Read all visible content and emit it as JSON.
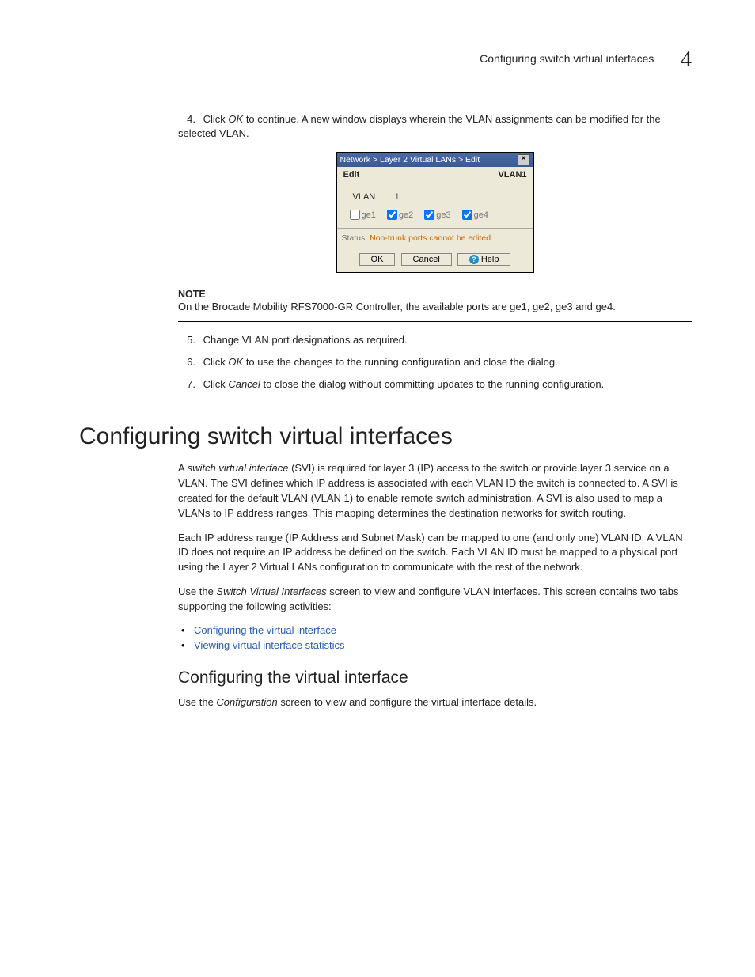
{
  "header": {
    "title": "Configuring switch virtual interfaces",
    "chapter": "4"
  },
  "step4": {
    "num": "4.",
    "prefix": "Click ",
    "ok": "OK",
    "rest": " to continue. A new window displays wherein the VLAN assignments can be modified for the selected VLAN."
  },
  "dialog": {
    "breadcrumb": "Network > Layer 2 Virtual LANs > Edit",
    "edit": "Edit",
    "vlan_name": "VLAN1",
    "vlan_label": "VLAN",
    "vlan_value": "1",
    "ports": {
      "ge1": "ge1",
      "ge2": "ge2",
      "ge3": "ge3",
      "ge4": "ge4"
    },
    "status_label": "Status:",
    "status_msg": "Non-trunk ports cannot be edited",
    "ok_btn": "OK",
    "cancel_btn": "Cancel",
    "help_btn": "Help"
  },
  "note": {
    "label": "NOTE",
    "body": "On the Brocade Mobility RFS7000-GR Controller, the available ports are ge1, ge2, ge3 and ge4."
  },
  "step5": {
    "num": "5.",
    "text": "Change VLAN port designations as required."
  },
  "step6": {
    "num": "6.",
    "prefix": "Click ",
    "ok": "OK",
    "rest": " to use the changes to the running configuration and close the dialog."
  },
  "step7": {
    "num": "7.",
    "prefix": "Click ",
    "cancel": "Cancel",
    "rest": " to close the dialog without committing updates to the running configuration."
  },
  "h1": "Configuring switch virtual interfaces",
  "p1": {
    "a": "A ",
    "svi": "switch virtual interface",
    "b": " (SVI) is required for layer 3 (IP) access to the switch or provide layer 3 service on a VLAN. The SVI defines which IP address is associated with each VLAN ID the switch is connected to. A SVI is created for the default VLAN (VLAN 1) to enable remote switch administration. A SVI is also used to map a VLANs to IP address ranges. This mapping determines the destination networks for switch routing."
  },
  "p2": "Each IP address range (IP Address and Subnet Mask) can be mapped to one (and only one) VLAN ID. A VLAN ID does not require an IP address be defined on the switch. Each VLAN ID must be mapped to a physical port using the Layer 2 Virtual LANs configuration to communicate with the rest of the network.",
  "p3": {
    "a": "Use the ",
    "screen": "Switch Virtual Interfaces",
    "b": " screen to view and configure VLAN interfaces. This screen contains two tabs supporting the following activities:"
  },
  "links": {
    "l1": "Configuring the virtual interface",
    "l2": "Viewing virtual interface statistics"
  },
  "h2": "Configuring the virtual interface",
  "p4": {
    "a": "Use the ",
    "conf": "Configuration",
    "b": " screen to view and configure the virtual interface details."
  }
}
